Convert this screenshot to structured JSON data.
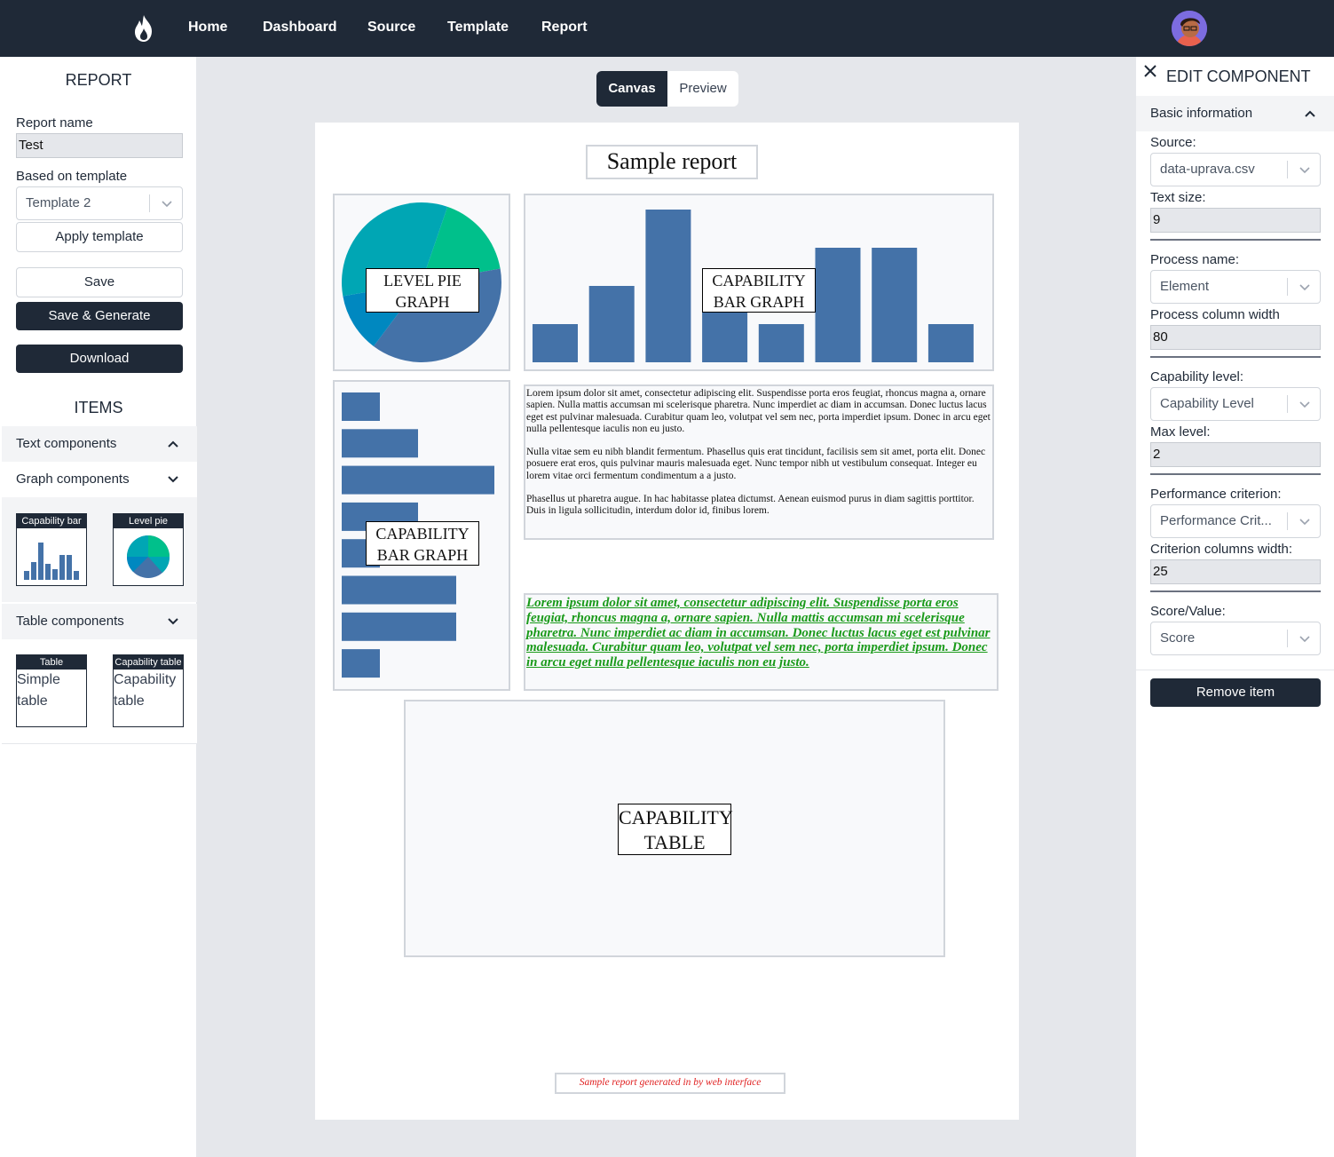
{
  "nav": {
    "links": [
      "Home",
      "Dashboard",
      "Source",
      "Template",
      "Report"
    ]
  },
  "left": {
    "title": "REPORT",
    "report_name_label": "Report name",
    "report_name_value": "Test",
    "template_label": "Based on template",
    "template_value": "Template 2",
    "apply_label": "Apply template",
    "save_label": "Save",
    "save_generate_label": "Save & Generate",
    "download_label": "Download",
    "items_title": "ITEMS",
    "sections": {
      "text": "Text components",
      "graph": "Graph components",
      "table": "Table components"
    },
    "graph_cards": [
      "Capability bar",
      "Level pie"
    ],
    "table_cards": [
      {
        "head": "Table",
        "body1": "Simple",
        "body2": "table"
      },
      {
        "head": "Capability table",
        "body1": "Capability",
        "body2": "table"
      }
    ]
  },
  "tabs": {
    "canvas": "Canvas",
    "preview": "Preview"
  },
  "report": {
    "title": "Sample report",
    "pie_label_1": "LEVEL PIE",
    "pie_label_2": "GRAPH",
    "bar_label_1": "CAPABILITY",
    "bar_label_2": "BAR GRAPH",
    "hbar_label_1": "CAPABILITY",
    "hbar_label_2": "BAR GRAPH",
    "table_label_1": "CAPABILITY",
    "table_label_2": "TABLE",
    "paragraph_1": "Lorem ipsum dolor sit amet, consectetur adipiscing elit. Suspendisse porta eros feugiat, rhoncus magna a, ornare sapien. Nulla mattis accumsan mi scelerisque pharetra. Nunc imperdiet ac diam in accumsan. Donec luctus lacus eget est pulvinar malesuada. Curabitur quam leo, volutpat vel sem nec, porta imperdiet ipsum. Donec in arcu eget nulla pellentesque iaculis non eu justo.",
    "paragraph_2": "Nulla vitae sem eu nibh blandit fermentum. Phasellus quis erat tincidunt, facilisis sem sit amet, porta elit. Donec posuere erat eros, quis pulvinar mauris malesuada eget. Nunc tempor nibh ut vestibulum consequat. Integer eu lorem vitae orci fermentum condimentum a a justo.",
    "paragraph_3": "Phasellus ut pharetra augue. In hac habitasse platea dictumst. Aenean euismod purus in diam sagittis porttitor. Duis in ligula sollicitudin, interdum dolor id, finibus lorem.",
    "green_text": "Lorem ipsum dolor sit amet, consectetur adipiscing elit. Suspendisse porta eros feugiat, rhoncus magna a, ornare sapien. Nulla mattis accumsan mi scelerisque pharetra. Nunc imperdiet ac diam in accumsan. Donec luctus lacus eget est pulvinar malesuada. Curabitur quam leo, volutpat vel sem nec, porta imperdiet ipsum. Donec in arcu eget nulla pellentesque iaculis non eu justo.",
    "footer": "Sample report generated in by web interface"
  },
  "right": {
    "title": "EDIT COMPONENT",
    "section": "Basic information",
    "source_label": "Source:",
    "source_value": "data-uprava.csv",
    "text_size_label": "Text size:",
    "text_size_value": "9",
    "process_name_label": "Process name:",
    "process_name_value": "Element",
    "process_width_label": "Process column width",
    "process_width_value": "80",
    "capability_label": "Capability level:",
    "capability_value": "Capability Level",
    "max_level_label": "Max level:",
    "max_level_value": "2",
    "criterion_label": "Performance criterion:",
    "criterion_value": "Performance Crit...",
    "criterion_width_label": "Criterion columns width:",
    "criterion_width_value": "25",
    "score_label": "Score/Value:",
    "score_value": "Score",
    "remove_label": "Remove item"
  },
  "colors": {
    "nav_bg": "#1f2937",
    "bar_blue": "#4472a8",
    "pie_teal": "#00a6b4",
    "pie_green": "#00c08b",
    "pie_blue": "#0088c0",
    "green_text": "#1a9a1a",
    "footer_red": "#e02020"
  },
  "chart_data": [
    {
      "type": "pie",
      "values": [
        0.33,
        0.17,
        0.38,
        0.12
      ],
      "colors": [
        "#00a6b4",
        "#00c08b",
        "#4472a8",
        "#0088c0"
      ]
    },
    {
      "type": "bar",
      "values": [
        1,
        2,
        4,
        1.5,
        1,
        3,
        3,
        1
      ]
    },
    {
      "type": "bar",
      "orientation": "horizontal",
      "values": [
        1,
        2,
        4,
        2,
        1,
        3,
        3,
        1
      ]
    }
  ]
}
